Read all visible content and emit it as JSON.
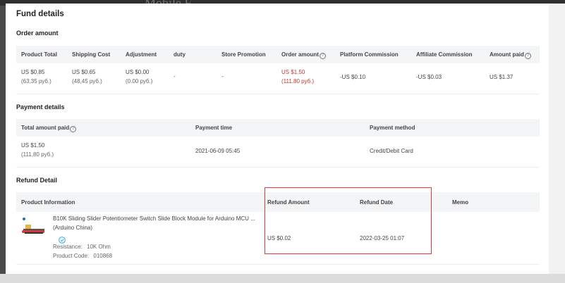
{
  "backdrop": {
    "partial_heading": "Mobile F"
  },
  "dialog": {
    "title": "Fund details"
  },
  "order": {
    "title": "Order amount",
    "headers": {
      "product_total": "Product Total",
      "shipping_cost": "Shipping Cost",
      "adjustment": "Adjustment",
      "duty": "duty",
      "store_promotion": "Store Promotion",
      "order_amount": "Order amount",
      "platform_commission": "Platform Commission",
      "affiliate_commission": "Affiliate Commission",
      "amount_paid": "Amount paid"
    },
    "values": {
      "product_total": "US $0.85",
      "product_total_local": "(63,35 руб.)",
      "shipping_cost": "US $0.65",
      "shipping_cost_local": "(48,45 руб.)",
      "adjustment": "US $0.00",
      "adjustment_local": "(0.00 руб.)",
      "duty": "-",
      "store_promotion": "-",
      "order_amount": "US $1.50",
      "order_amount_local": "(111.80 руб.)",
      "platform_commission": "-US $0.10",
      "affiliate_commission": "-US $0.03",
      "amount_paid": "US $1.37"
    }
  },
  "payment": {
    "title": "Payment details",
    "headers": {
      "total_paid": "Total amount paid",
      "payment_time": "Payment time",
      "payment_method": "Payment method"
    },
    "values": {
      "total_paid": "US $1.50",
      "total_paid_local": "(111,80 руб.)",
      "payment_time": "2021-06-09 05:45",
      "payment_method": "Credit/Debit Card"
    }
  },
  "refund": {
    "title": "Refund Detail",
    "headers": {
      "product_info": "Product Information",
      "refund_amount": "Refund Amount",
      "refund_date": "Refund Date",
      "memo": "Memo"
    },
    "product": {
      "name": "B10K Sliding Slider Potentiometer Switch Slide Block Module for Arduino MCU ...",
      "seller": "(Arduino China)",
      "resistance_label": "Resistance:",
      "resistance_value": "10K Ohm",
      "code_label": "Product Code:",
      "code_value": "010868"
    },
    "values": {
      "refund_amount": "US $0.02",
      "refund_date": "2022-03-25 01:07",
      "memo": ""
    }
  },
  "colors": {
    "highlight": "#e53935",
    "order_amount_accent": "#c0392b",
    "verified": "#2aa8d6"
  }
}
